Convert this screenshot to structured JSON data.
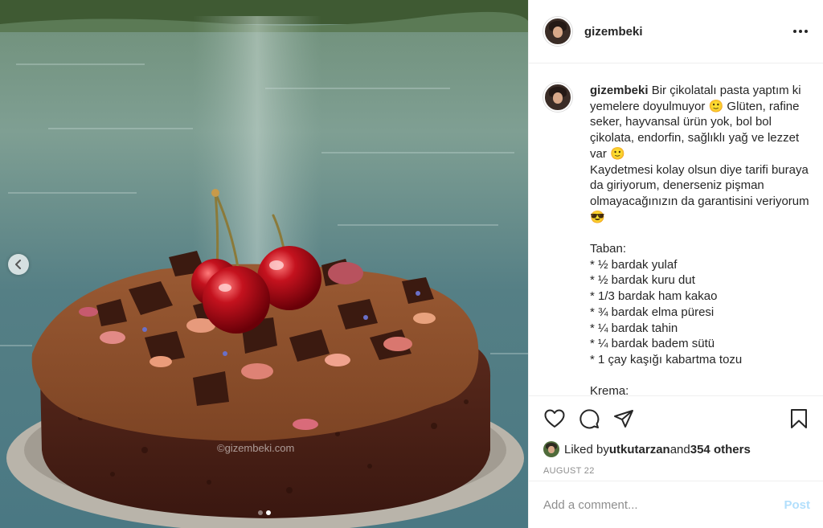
{
  "post": {
    "username": "gizembeki",
    "watermark": "©gizembeki.com",
    "caption": {
      "username": "gizembeki",
      "text": " Bir çikolatalı pasta yaptım ki yemelere doyulmuyor 🙂 Glüten, rafine seker, hayvansal ürün yok, bol bol çikolata, endorfin, sağlıklı yağ ve lezzet var 🙂\nKaydetmesi kolay olsun diye tarifi buraya da giriyorum, denerseniz pişman olmayacağınızın da garantisini veriyorum 😎\n\nTaban:\n* ½ bardak yulaf\n* ½ bardak kuru dut\n* 1/3 bardak ham kakao\n* ¾ bardak elma püresi\n* ¼ bardak tahin\n* ¼ bardak badem sütü\n* 1 çay kaşığı kabartma tozu\n\nKrema:"
    },
    "likes": {
      "prefix": "Liked by ",
      "user": "utkutarzan",
      "middle": " and ",
      "count": "354 others"
    },
    "date": "AUGUST 22",
    "comment": {
      "placeholder": "Add a comment...",
      "post_label": "Post"
    },
    "carousel": {
      "current": 2,
      "total": 2
    }
  },
  "icons": {
    "more": "more-options-icon",
    "like": "heart-icon",
    "comment": "comment-icon",
    "share": "share-icon",
    "save": "bookmark-icon",
    "prev": "chevron-left-icon"
  },
  "colors": {
    "link": "#b2dffc",
    "muted": "#8e8e8e",
    "text": "#262626",
    "border": "#efefef"
  }
}
